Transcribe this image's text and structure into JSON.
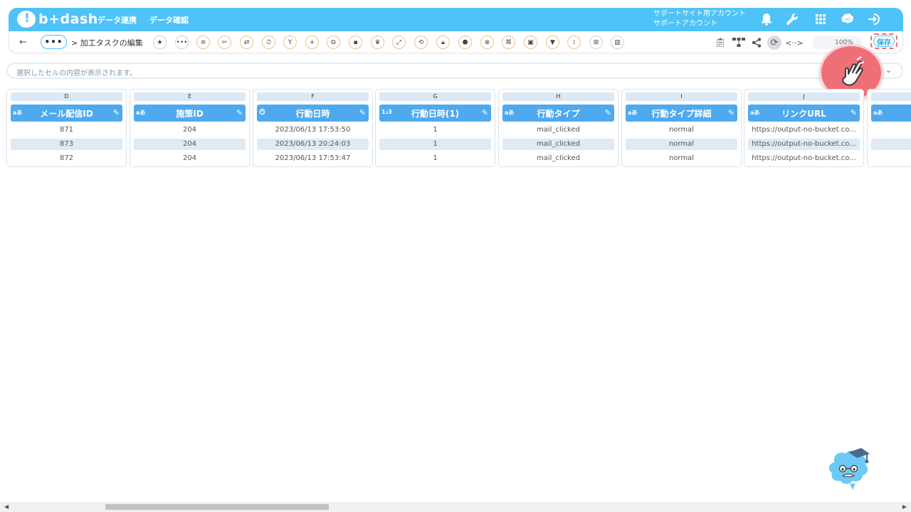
{
  "app": {
    "logo_text": "b+dash",
    "nav": [
      "データ連携",
      "データ確認"
    ],
    "account_line1": "サポートサイト用アカウント",
    "account_line2": "サポートアカウント"
  },
  "toolbar": {
    "more_label": "•••",
    "breadcrumb": "> 加工タスクの編集",
    "zoom_label": "100%",
    "save_label": "保存"
  },
  "cell_bar": {
    "placeholder": "選択したセルの内容が表示されます。"
  },
  "columns": [
    {
      "letter": "D",
      "type": "aあ",
      "name": "メール配信ID",
      "values": [
        "871",
        "873",
        "872"
      ]
    },
    {
      "letter": "E",
      "type": "aあ",
      "name": "施策ID",
      "values": [
        "204",
        "204",
        "204"
      ]
    },
    {
      "letter": "F",
      "type": "⏱",
      "name": "行動日時",
      "values": [
        "2023/06/13 17:53:50",
        "2023/06/13 20:24:03",
        "2023/06/13 17:53:47"
      ]
    },
    {
      "letter": "G",
      "type": "1₂3",
      "name": "行動日時(1)",
      "values": [
        "1",
        "1",
        "1"
      ]
    },
    {
      "letter": "H",
      "type": "aあ",
      "name": "行動タイプ",
      "values": [
        "mail_clicked",
        "mail_clicked",
        "mail_clicked"
      ]
    },
    {
      "letter": "I",
      "type": "aあ",
      "name": "行動タイプ詳細",
      "values": [
        "normal",
        "normal",
        "normal"
      ]
    },
    {
      "letter": "J",
      "type": "aあ",
      "name": "リンクURL",
      "values": [
        "https://output-no-bucket.co...",
        "https://output-no-bucket.co...",
        "https://output-no-bucket.co..."
      ]
    },
    {
      "letter": "",
      "type": "aあ",
      "name": "",
      "values": [
        "",
        "",
        ""
      ]
    }
  ],
  "colors": {
    "brand": "#4fc3f7",
    "header": "#4fa9ee",
    "row_alt": "#dfeaf5",
    "save_highlight": "#e57373",
    "pointer_overlay": "#ef6f78"
  }
}
